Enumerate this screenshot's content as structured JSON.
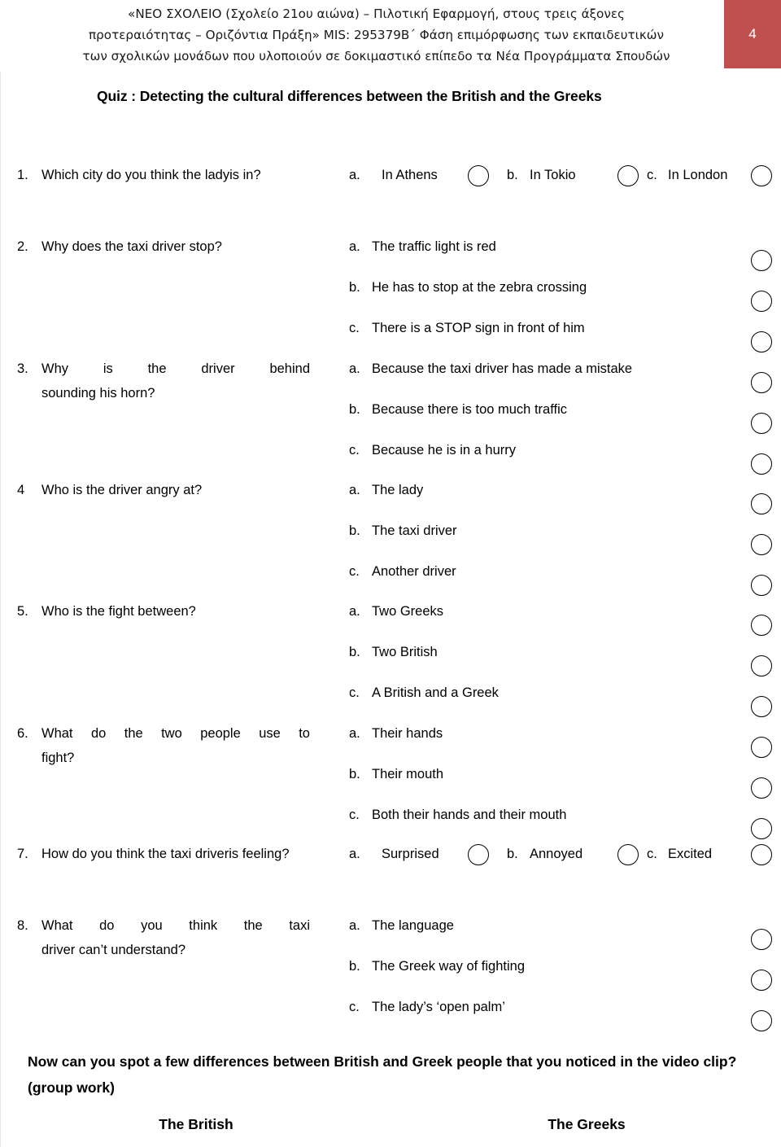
{
  "header": {
    "lines": [
      "«ΝΕΟ ΣΧΟΛΕΙΟ (Σχολείο 21ου αιώνα) – Πιλοτική Εφαρμογή, στους τρεις άξονες",
      "προτεραιότητας – Οριζόντια Πράξη»  MIS: 295379Β΄ Φάση επιμόρφωσης των εκπαιδευτικών",
      "των σχολικών μονάδων που υλοποιούν σε δοκιμαστικό επίπεδο τα Νέα Προγράμματα Σπουδών"
    ],
    "page_number": "4",
    "badge_color": "#c0504d"
  },
  "quiz": {
    "title": "Quiz : Detecting the cultural differences between the British and the Greeks",
    "questions": [
      {
        "number": "1.",
        "text_line1": "Which city do you think the lady",
        "text_line2": "is in?",
        "layout": "inline",
        "options": [
          {
            "label": "a.",
            "text": "In Athens"
          },
          {
            "label": "b.",
            "text": "In Tokio"
          },
          {
            "label": "c.",
            "text": "In London"
          }
        ]
      },
      {
        "number": "2.",
        "text_line1": "Why does the taxi driver stop?",
        "text_line2": "",
        "layout": "stacked",
        "options": [
          {
            "label": "a.",
            "text": "The traffic light is red"
          },
          {
            "label": "b.",
            "text": "He has to stop at the zebra crossing"
          },
          {
            "label": "c.",
            "text": "There is a STOP sign in front of him"
          }
        ]
      },
      {
        "number": "3.",
        "text_line1": "Why is the driver behind",
        "text_line2": "sounding his horn?",
        "layout": "stacked",
        "justify": true,
        "options": [
          {
            "label": "a.",
            "text": "Because the taxi driver has made a mistake"
          },
          {
            "label": "b.",
            "text": "Because  there is too much traffic"
          },
          {
            "label": "c.",
            "text": "Because he is in a hurry"
          }
        ]
      },
      {
        "number": "4",
        "text_line1": "Who is the driver angry at?",
        "text_line2": "",
        "layout": "stacked",
        "options": [
          {
            "label": "a.",
            "text": "The lady"
          },
          {
            "label": "b.",
            "text": "The taxi driver"
          },
          {
            "label": "c.",
            "text": "Another driver"
          }
        ]
      },
      {
        "number": "5.",
        "text_line1": "Who is the fight between?",
        "text_line2": "",
        "layout": "stacked",
        "options": [
          {
            "label": "a.",
            "text": "Two Greeks"
          },
          {
            "label": "b.",
            "text": "Two British"
          },
          {
            "label": "c.",
            "text": "A British and a Greek"
          }
        ]
      },
      {
        "number": "6.",
        "text_line1": "What do the two people use to",
        "text_line2": "fight?",
        "layout": "stacked",
        "justify": true,
        "options": [
          {
            "label": "a.",
            "text": "Their hands"
          },
          {
            "label": "b.",
            "text": "Their mouth"
          },
          {
            "label": "c.",
            "text": "Both their hands and their mouth"
          }
        ]
      },
      {
        "number": "7.",
        "text_line1": "How do you think the taxi driver",
        "text_line2": "is feeling?",
        "layout": "inline",
        "options": [
          {
            "label": "a.",
            "text": "Surprised"
          },
          {
            "label": "b.",
            "text": "Annoyed"
          },
          {
            "label": "c.",
            "text": "Excited"
          }
        ]
      },
      {
        "number": "8.",
        "text_line1": "What do you think the taxi",
        "text_line2": "driver can’t understand?",
        "layout": "stacked",
        "justify": true,
        "options": [
          {
            "label": "a.",
            "text": "The language"
          },
          {
            "label": "b.",
            "text": "The Greek way of fighting"
          },
          {
            "label": "c.",
            "text": "The lady’s ‘open palm’"
          }
        ]
      }
    ]
  },
  "footer": {
    "closing_line1": "Now can you spot a few differences between British and Greek people that you noticed in",
    "closing_line2": "the video clip? (group work)",
    "columns": [
      {
        "heading": "The British"
      },
      {
        "heading": "The Greeks"
      }
    ]
  }
}
